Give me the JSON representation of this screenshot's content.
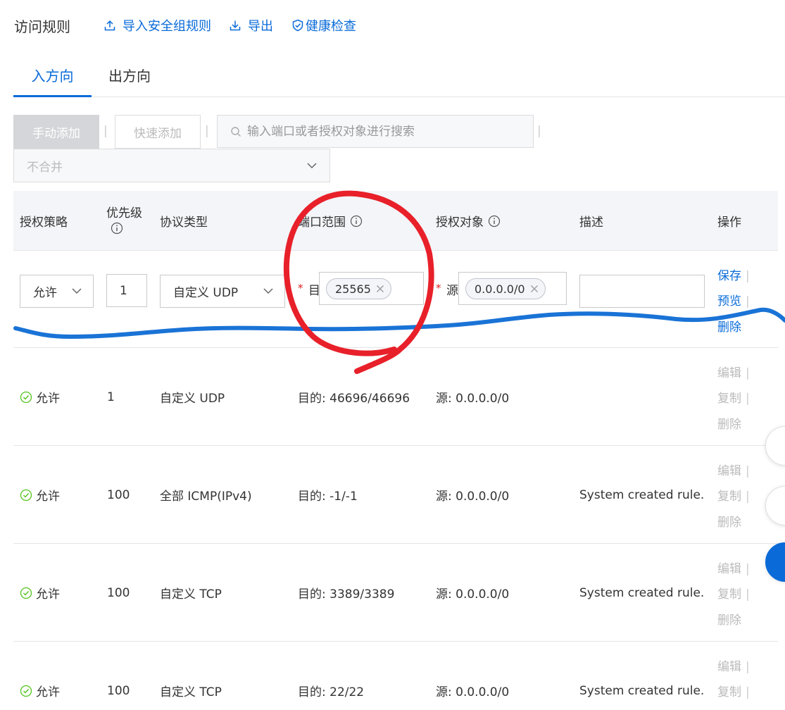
{
  "header": {
    "title": "访问规则",
    "links": [
      {
        "label": "导入安全组规则",
        "icon": "upload-icon"
      },
      {
        "label": "导出",
        "icon": "download-icon"
      },
      {
        "label": "健康检查",
        "icon": "shield-check-icon"
      }
    ]
  },
  "tabs": [
    {
      "label": "入方向",
      "active": true
    },
    {
      "label": "出方向",
      "active": false
    }
  ],
  "toolbar": {
    "manual_add": "手动添加",
    "quick_add": "快速添加",
    "search_placeholder": "输入端口或者授权对象进行搜索",
    "merge_value": "不合并"
  },
  "table": {
    "columns": [
      "授权策略",
      "优先级",
      "协议类型",
      "端口范围",
      "授权对象",
      "描述",
      "操作"
    ],
    "edit_row": {
      "policy": "允许",
      "priority": "1",
      "protocol": "自定义 UDP",
      "port_prefix": "目",
      "port_tag": "25565",
      "source_prefix": "源",
      "source_tag": "0.0.0.0/0",
      "description": "",
      "actions": [
        "保存",
        "预览",
        "删除"
      ]
    },
    "rows": [
      {
        "policy": "允许",
        "priority": "1",
        "protocol": "自定义 UDP",
        "port": "目的: 46696/46696",
        "source": "源: 0.0.0.0/0",
        "description": "",
        "actions": [
          "编辑",
          "复制",
          "删除"
        ]
      },
      {
        "policy": "允许",
        "priority": "100",
        "protocol": "全部 ICMP(IPv4)",
        "port": "目的: -1/-1",
        "source": "源: 0.0.0.0/0",
        "description": "System created rule.",
        "actions": [
          "编辑",
          "复制",
          "删除"
        ]
      },
      {
        "policy": "允许",
        "priority": "100",
        "protocol": "自定义 TCP",
        "port": "目的: 3389/3389",
        "source": "源: 0.0.0.0/0",
        "description": "System created rule.",
        "actions": [
          "编辑",
          "复制",
          "删除"
        ]
      },
      {
        "policy": "允许",
        "priority": "100",
        "protocol": "自定义 TCP",
        "port": "目的: 22/22",
        "source": "源: 0.0.0.0/0",
        "description": "System created rule.",
        "actions": [
          "编辑",
          "复制"
        ]
      }
    ]
  },
  "colors": {
    "accent": "#0a6bd8",
    "success": "#52c41a",
    "annotation_red": "#e8202a",
    "annotation_blue": "#1a73d6"
  }
}
